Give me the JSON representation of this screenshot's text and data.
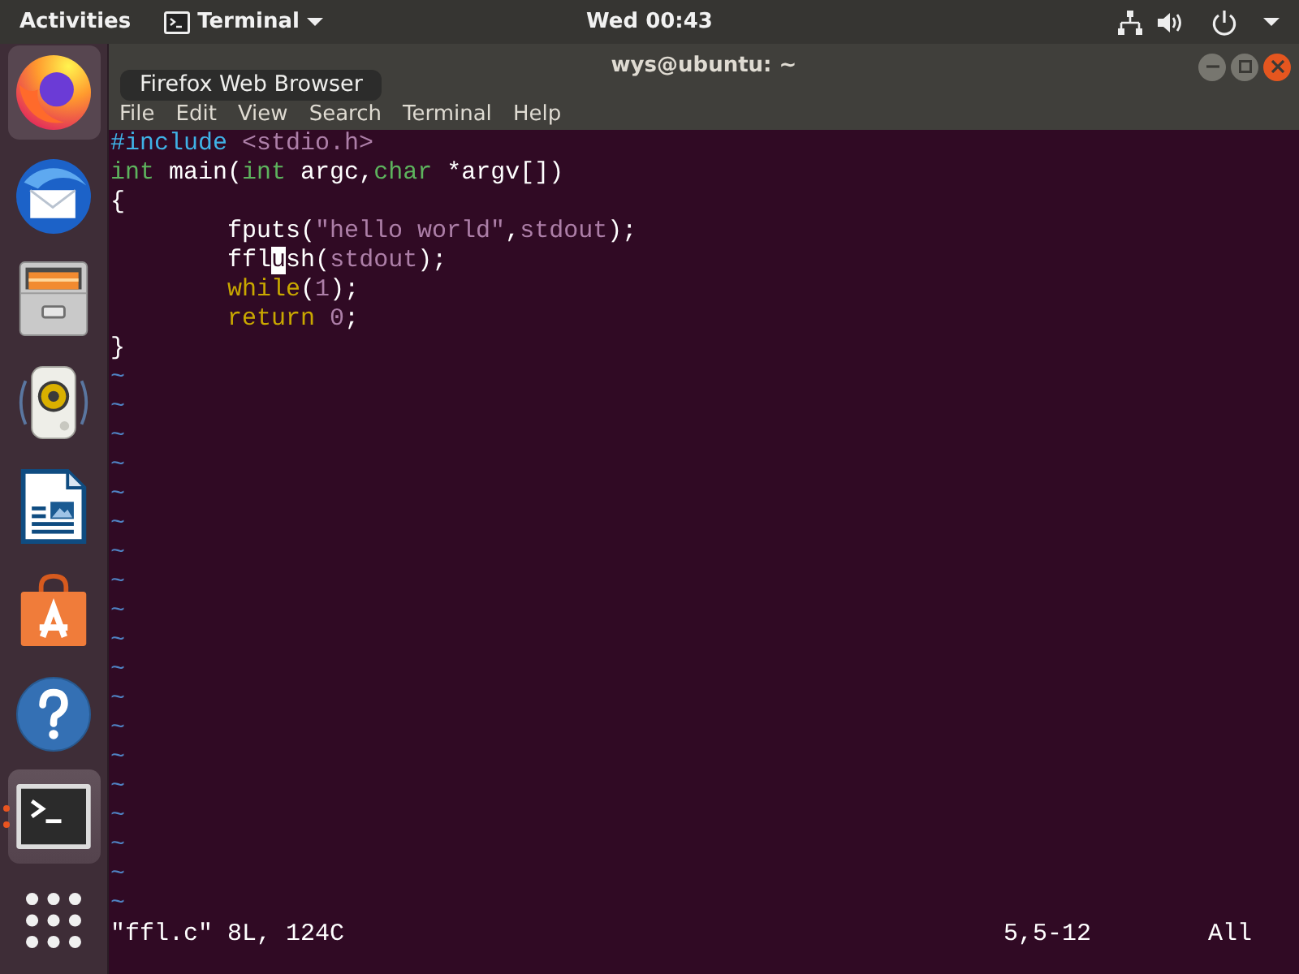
{
  "top_bar": {
    "activities": "Activities",
    "app_menu": "Terminal",
    "clock": "Wed 00:43"
  },
  "dock": {
    "items": [
      {
        "kind": "browser",
        "hovered": true,
        "selected": false,
        "running": false,
        "tooltip": "Firefox Web Browser"
      },
      {
        "kind": "mail",
        "hovered": false,
        "selected": false,
        "running": false
      },
      {
        "kind": "files",
        "hovered": false,
        "selected": false,
        "running": false
      },
      {
        "kind": "music",
        "hovered": false,
        "selected": false,
        "running": false
      },
      {
        "kind": "writer",
        "hovered": false,
        "selected": false,
        "running": false
      },
      {
        "kind": "software",
        "hovered": false,
        "selected": false,
        "running": false
      },
      {
        "kind": "help",
        "hovered": false,
        "selected": false,
        "running": false
      },
      {
        "kind": "terminal",
        "hovered": false,
        "selected": true,
        "running": true
      }
    ]
  },
  "window": {
    "title": "wys@ubuntu: ~",
    "menu": [
      "File",
      "Edit",
      "View",
      "Search",
      "Terminal",
      "Help"
    ]
  },
  "editor": {
    "lines": [
      {
        "segments": [
          {
            "text": "#include ",
            "kind": "preproc"
          },
          {
            "text": "<stdio.h>",
            "kind": "string"
          }
        ]
      },
      {
        "segments": [
          {
            "text": "int",
            "kind": "type"
          },
          {
            "text": " main(",
            "kind": "plain"
          },
          {
            "text": "int",
            "kind": "type"
          },
          {
            "text": " argc,",
            "kind": "plain"
          },
          {
            "text": "char",
            "kind": "type"
          },
          {
            "text": " *argv[])",
            "kind": "plain"
          }
        ]
      },
      {
        "segments": [
          {
            "text": "{",
            "kind": "plain"
          }
        ]
      },
      {
        "segments": [
          {
            "text": "\tfputs(",
            "kind": "plain"
          },
          {
            "text": "\"hello world\"",
            "kind": "string"
          },
          {
            "text": ",",
            "kind": "plain"
          },
          {
            "text": "stdout",
            "kind": "constant"
          },
          {
            "text": ");",
            "kind": "plain"
          }
        ]
      },
      {
        "segments": [
          {
            "text": "\tffl",
            "kind": "plain"
          },
          {
            "text": "u",
            "kind": "cursor"
          },
          {
            "text": "sh(",
            "kind": "plain"
          },
          {
            "text": "stdout",
            "kind": "constant"
          },
          {
            "text": ");",
            "kind": "plain"
          }
        ]
      },
      {
        "segments": [
          {
            "text": "\twhile",
            "kind": "statement"
          },
          {
            "text": "(",
            "kind": "plain"
          },
          {
            "text": "1",
            "kind": "constant"
          },
          {
            "text": ");",
            "kind": "plain"
          }
        ]
      },
      {
        "segments": [
          {
            "text": "\treturn ",
            "kind": "statement"
          },
          {
            "text": "0",
            "kind": "constant"
          },
          {
            "text": ";",
            "kind": "plain"
          }
        ]
      },
      {
        "segments": [
          {
            "text": "}",
            "kind": "plain"
          }
        ]
      }
    ],
    "tildes": [
      "~",
      "~",
      "~",
      "~",
      "~",
      "~",
      "~",
      "~",
      "~",
      "~",
      "~",
      "~",
      "~",
      "~",
      "~",
      "~",
      "~",
      "~",
      "~"
    ],
    "status": {
      "message": "\"ffl.c\" 8L, 124C",
      "position": "5,5-12",
      "scroll": "All"
    }
  }
}
